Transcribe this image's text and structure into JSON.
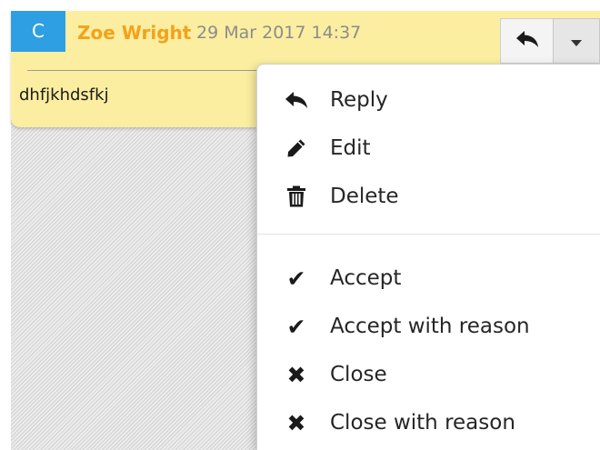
{
  "comment": {
    "avatar_letter": "C",
    "author": "Zoe Wright",
    "timestamp": "29 Mar 2017 14:37",
    "body": "dhfjkhdsfkj"
  },
  "actions": {
    "reply_icon": "reply-icon",
    "dropdown_icon": "caret-down-icon"
  },
  "menu": {
    "items": [
      {
        "label": "Reply",
        "icon": "reply-icon"
      },
      {
        "label": "Edit",
        "icon": "pencil-icon"
      },
      {
        "label": "Delete",
        "icon": "trash-icon"
      },
      {
        "label": "Accept",
        "icon": "check-icon"
      },
      {
        "label": "Accept with reason",
        "icon": "check-icon"
      },
      {
        "label": "Close",
        "icon": "x-icon"
      },
      {
        "label": "Close with reason",
        "icon": "x-icon"
      }
    ]
  },
  "colors": {
    "card_background": "#fbeea0",
    "avatar_background": "#2e9fe3",
    "author": "#f3a21b",
    "timestamp": "#8c8c8c"
  }
}
